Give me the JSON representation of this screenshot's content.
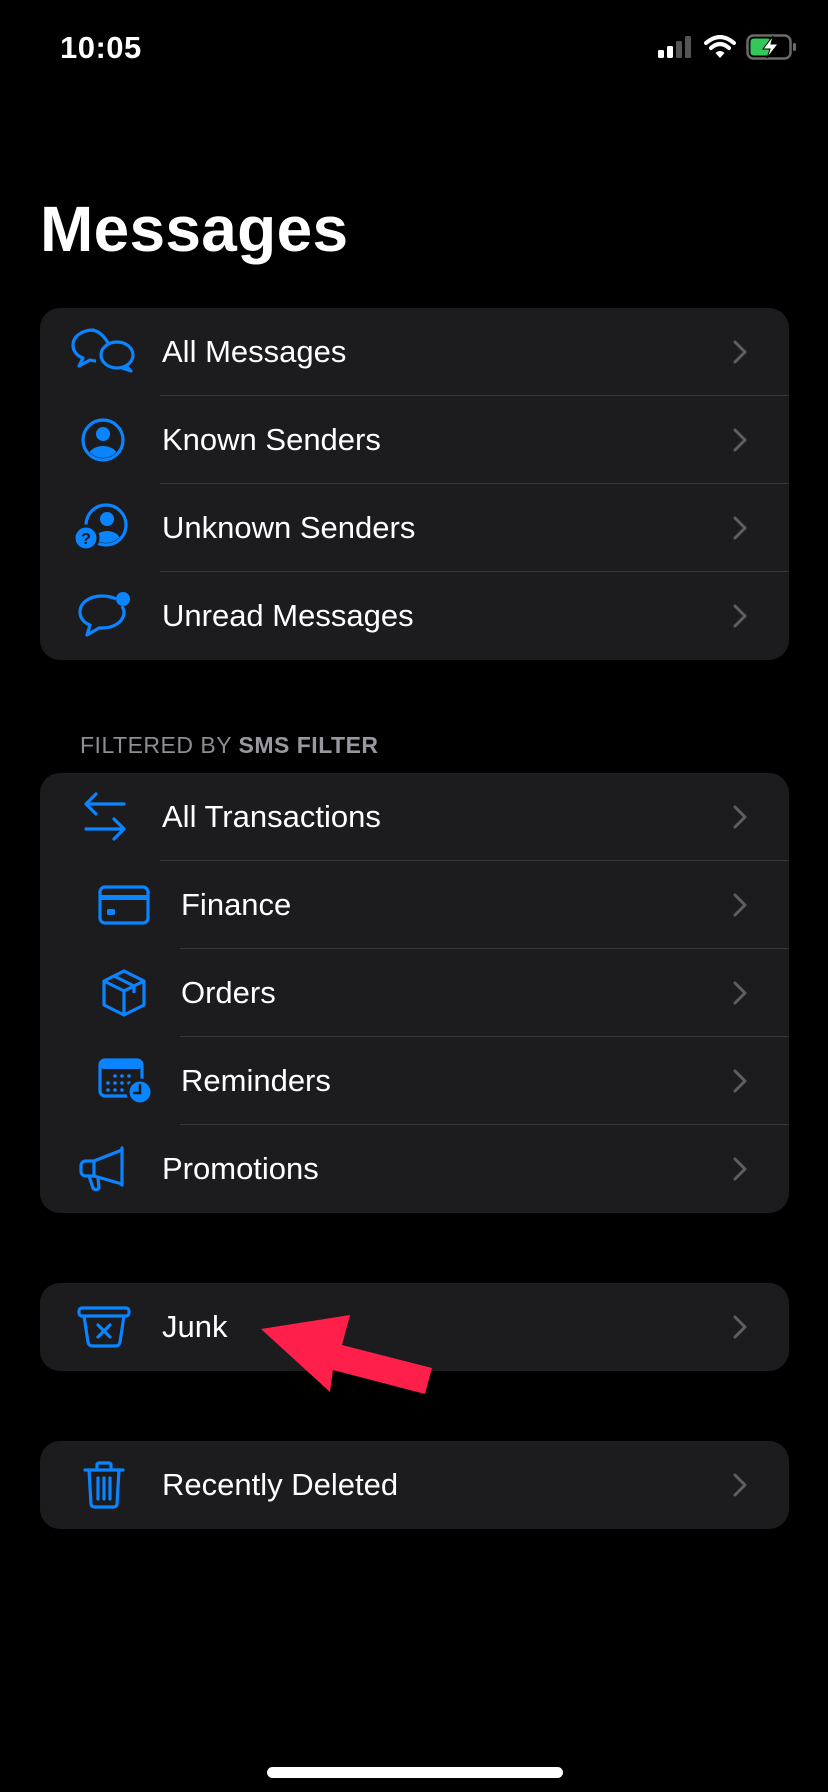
{
  "status_bar": {
    "time": "10:05",
    "signal_icon": "cellular-signal-icon",
    "wifi_icon": "wifi-icon",
    "battery_icon": "battery-charging-icon",
    "battery_color": "#34c759"
  },
  "header": {
    "title": "Messages"
  },
  "accent_color": "#0a84ff",
  "groups": [
    {
      "items": [
        {
          "label": "All Messages",
          "icon": "chat-bubbles-icon"
        },
        {
          "label": "Known Senders",
          "icon": "person-circle-icon"
        },
        {
          "label": "Unknown Senders",
          "icon": "person-question-icon"
        },
        {
          "label": "Unread Messages",
          "icon": "chat-bubble-badge-icon"
        }
      ]
    },
    {
      "header_prefix": "FILTERED BY ",
      "header_bold": "SMS FILTER",
      "items": [
        {
          "label": "All Transactions",
          "icon": "arrows-exchange-icon"
        },
        {
          "label": "Finance",
          "icon": "credit-card-icon"
        },
        {
          "label": "Orders",
          "icon": "shipping-box-icon"
        },
        {
          "label": "Reminders",
          "icon": "calendar-clock-icon"
        },
        {
          "label": "Promotions",
          "icon": "megaphone-icon"
        }
      ]
    },
    {
      "items": [
        {
          "label": "Junk",
          "icon": "junk-bin-icon"
        }
      ]
    },
    {
      "items": [
        {
          "label": "Recently Deleted",
          "icon": "trash-icon"
        }
      ]
    }
  ],
  "annotation": {
    "type": "arrow",
    "color": "#ff1f4b",
    "points_to": "Junk"
  }
}
